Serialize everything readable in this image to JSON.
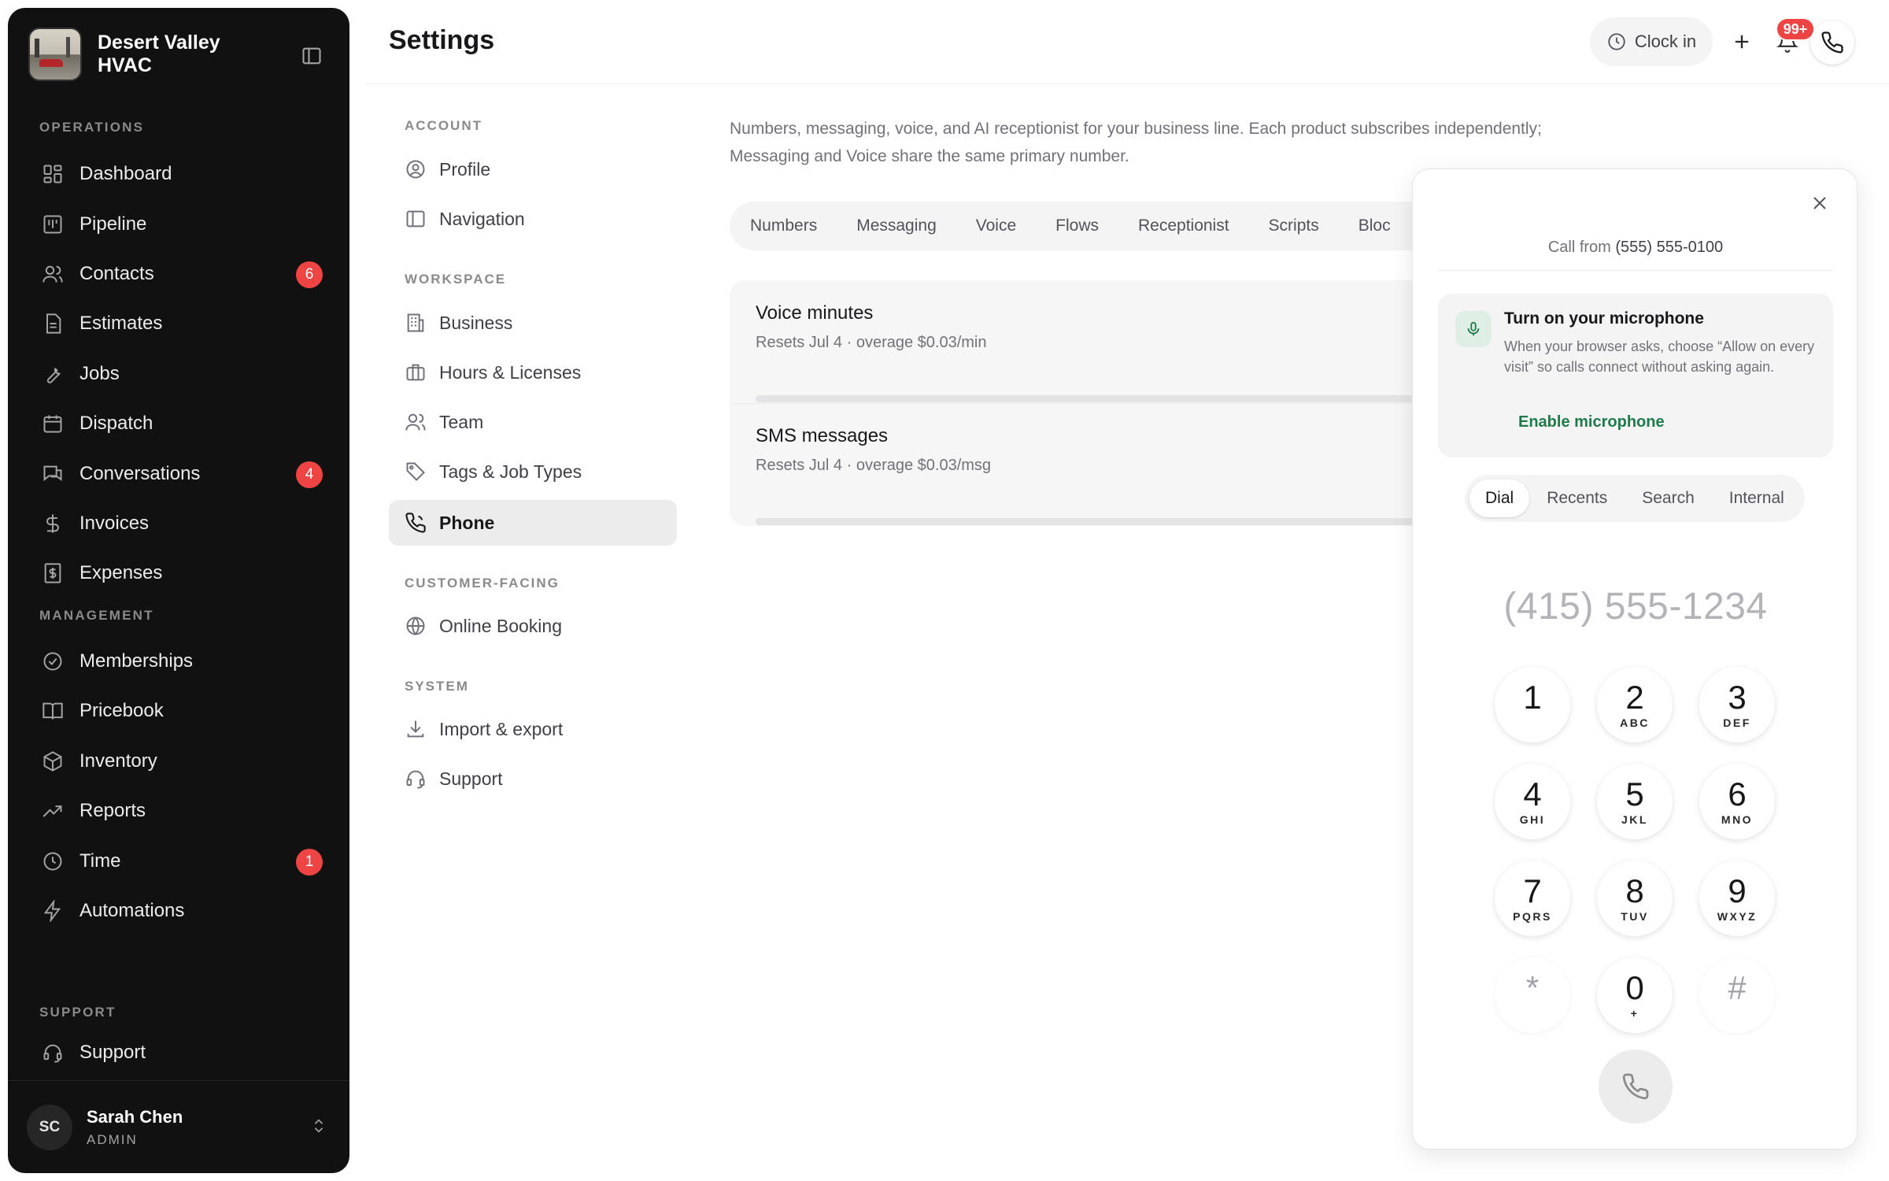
{
  "app": {
    "business_name": "Desert Valley HVAC"
  },
  "sidebar": {
    "sections": {
      "operations": "OPERATIONS",
      "management": "MANAGEMENT",
      "support": "SUPPORT"
    },
    "operations": [
      {
        "label": "Dashboard",
        "icon": "dashboard-icon"
      },
      {
        "label": "Pipeline",
        "icon": "pipeline-icon"
      },
      {
        "label": "Contacts",
        "icon": "contacts-icon",
        "badge": "6"
      },
      {
        "label": "Estimates",
        "icon": "estimates-icon"
      },
      {
        "label": "Jobs",
        "icon": "wrench-icon"
      },
      {
        "label": "Dispatch",
        "icon": "calendar-icon"
      },
      {
        "label": "Conversations",
        "icon": "chat-icon",
        "badge": "4"
      },
      {
        "label": "Invoices",
        "icon": "dollar-icon"
      },
      {
        "label": "Expenses",
        "icon": "receipt-icon"
      }
    ],
    "management": [
      {
        "label": "Memberships",
        "icon": "badge-check-icon"
      },
      {
        "label": "Pricebook",
        "icon": "book-icon"
      },
      {
        "label": "Inventory",
        "icon": "package-icon"
      },
      {
        "label": "Reports",
        "icon": "trending-icon"
      },
      {
        "label": "Time",
        "icon": "clock-icon",
        "badge": "1"
      },
      {
        "label": "Automations",
        "icon": "lightning-icon"
      }
    ],
    "support": [
      {
        "label": "Support",
        "icon": "headset-icon"
      }
    ],
    "user": {
      "initials": "SC",
      "name": "Sarah Chen",
      "role": "ADMIN"
    }
  },
  "header": {
    "title": "Settings",
    "clock_in_label": "Clock in",
    "notification_badge": "99+"
  },
  "settings_nav": {
    "sections": {
      "account": "ACCOUNT",
      "workspace": "WORKSPACE",
      "customer_facing": "CUSTOMER-FACING",
      "system": "SYSTEM"
    },
    "account": [
      "Profile",
      "Navigation"
    ],
    "workspace": [
      "Business",
      "Hours & Licenses",
      "Team",
      "Tags & Job Types",
      "Phone"
    ],
    "customer_facing": [
      "Online Booking"
    ],
    "system": [
      "Import & export",
      "Support"
    ],
    "active": "Phone"
  },
  "phone": {
    "description": "Numbers, messaging, voice, and AI receptionist for your business line. Each product subscribes independently; Messaging and Voice share the same primary number.",
    "tabs": [
      "Numbers",
      "Messaging",
      "Voice",
      "Flows",
      "Receptionist",
      "Scripts",
      "Bloc"
    ],
    "usage": [
      {
        "title": "Voice minutes",
        "subtitle": "Resets Jul 4 · overage $0.03/min"
      },
      {
        "title": "SMS messages",
        "subtitle": "Resets Jul 4 · overage $0.03/msg"
      }
    ]
  },
  "dialer": {
    "call_from_label": "Call from",
    "call_from_number": "(555) 555-0100",
    "mic": {
      "title": "Turn on your microphone",
      "text": "When your browser asks, choose “Allow on every visit” so calls connect without asking again.",
      "link": "Enable microphone"
    },
    "tabs": [
      "Dial",
      "Recents",
      "Search",
      "Internal"
    ],
    "active_tab": "Dial",
    "number_placeholder": "(415) 555-1234",
    "keys": [
      {
        "digit": "1",
        "letters": ""
      },
      {
        "digit": "2",
        "letters": "ABC"
      },
      {
        "digit": "3",
        "letters": "DEF"
      },
      {
        "digit": "4",
        "letters": "GHI"
      },
      {
        "digit": "5",
        "letters": "JKL"
      },
      {
        "digit": "6",
        "letters": "MNO"
      },
      {
        "digit": "7",
        "letters": "PQRS"
      },
      {
        "digit": "8",
        "letters": "TUV"
      },
      {
        "digit": "9",
        "letters": "WXYZ"
      },
      {
        "digit": "*",
        "letters": ""
      },
      {
        "digit": "0",
        "letters": "+"
      },
      {
        "digit": "#",
        "letters": ""
      }
    ]
  }
}
